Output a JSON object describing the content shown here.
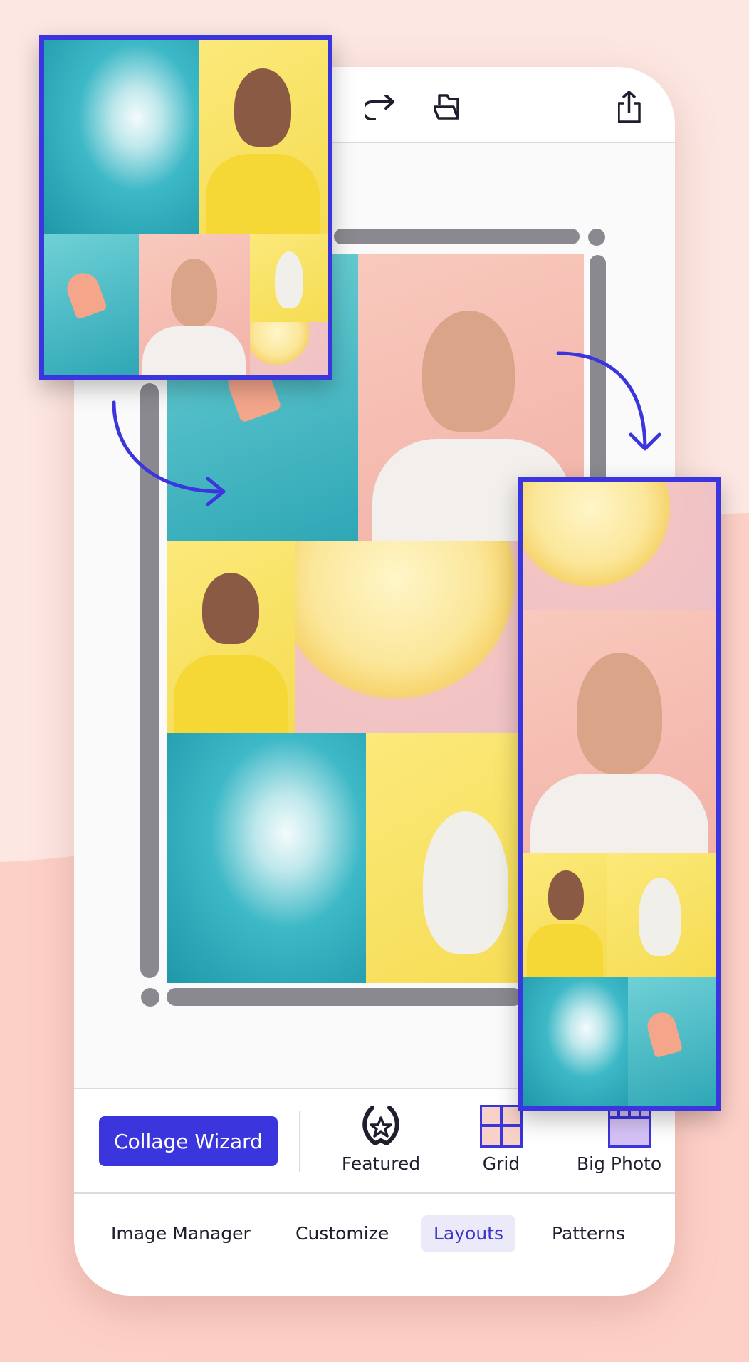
{
  "toolbar": {
    "icons": [
      "redo-icon",
      "folder-open-icon",
      "share-icon"
    ]
  },
  "bottom_toolbar": {
    "wizard_label": "Collage Wizard",
    "layouts": [
      {
        "label": "Featured",
        "icon": "laurel-star-icon"
      },
      {
        "label": "Grid",
        "icon": "grid-icon"
      },
      {
        "label": "Big Photo",
        "icon": "big-photo-icon"
      }
    ]
  },
  "tabs": [
    {
      "label": "Image Manager",
      "active": false
    },
    {
      "label": "Customize",
      "active": false
    },
    {
      "label": "Layouts",
      "active": true
    },
    {
      "label": "Patterns",
      "active": false
    }
  ],
  "colors": {
    "accent": "#3b35dd",
    "background": "#fde7e2",
    "active_tab_bg": "#eceaf9"
  }
}
